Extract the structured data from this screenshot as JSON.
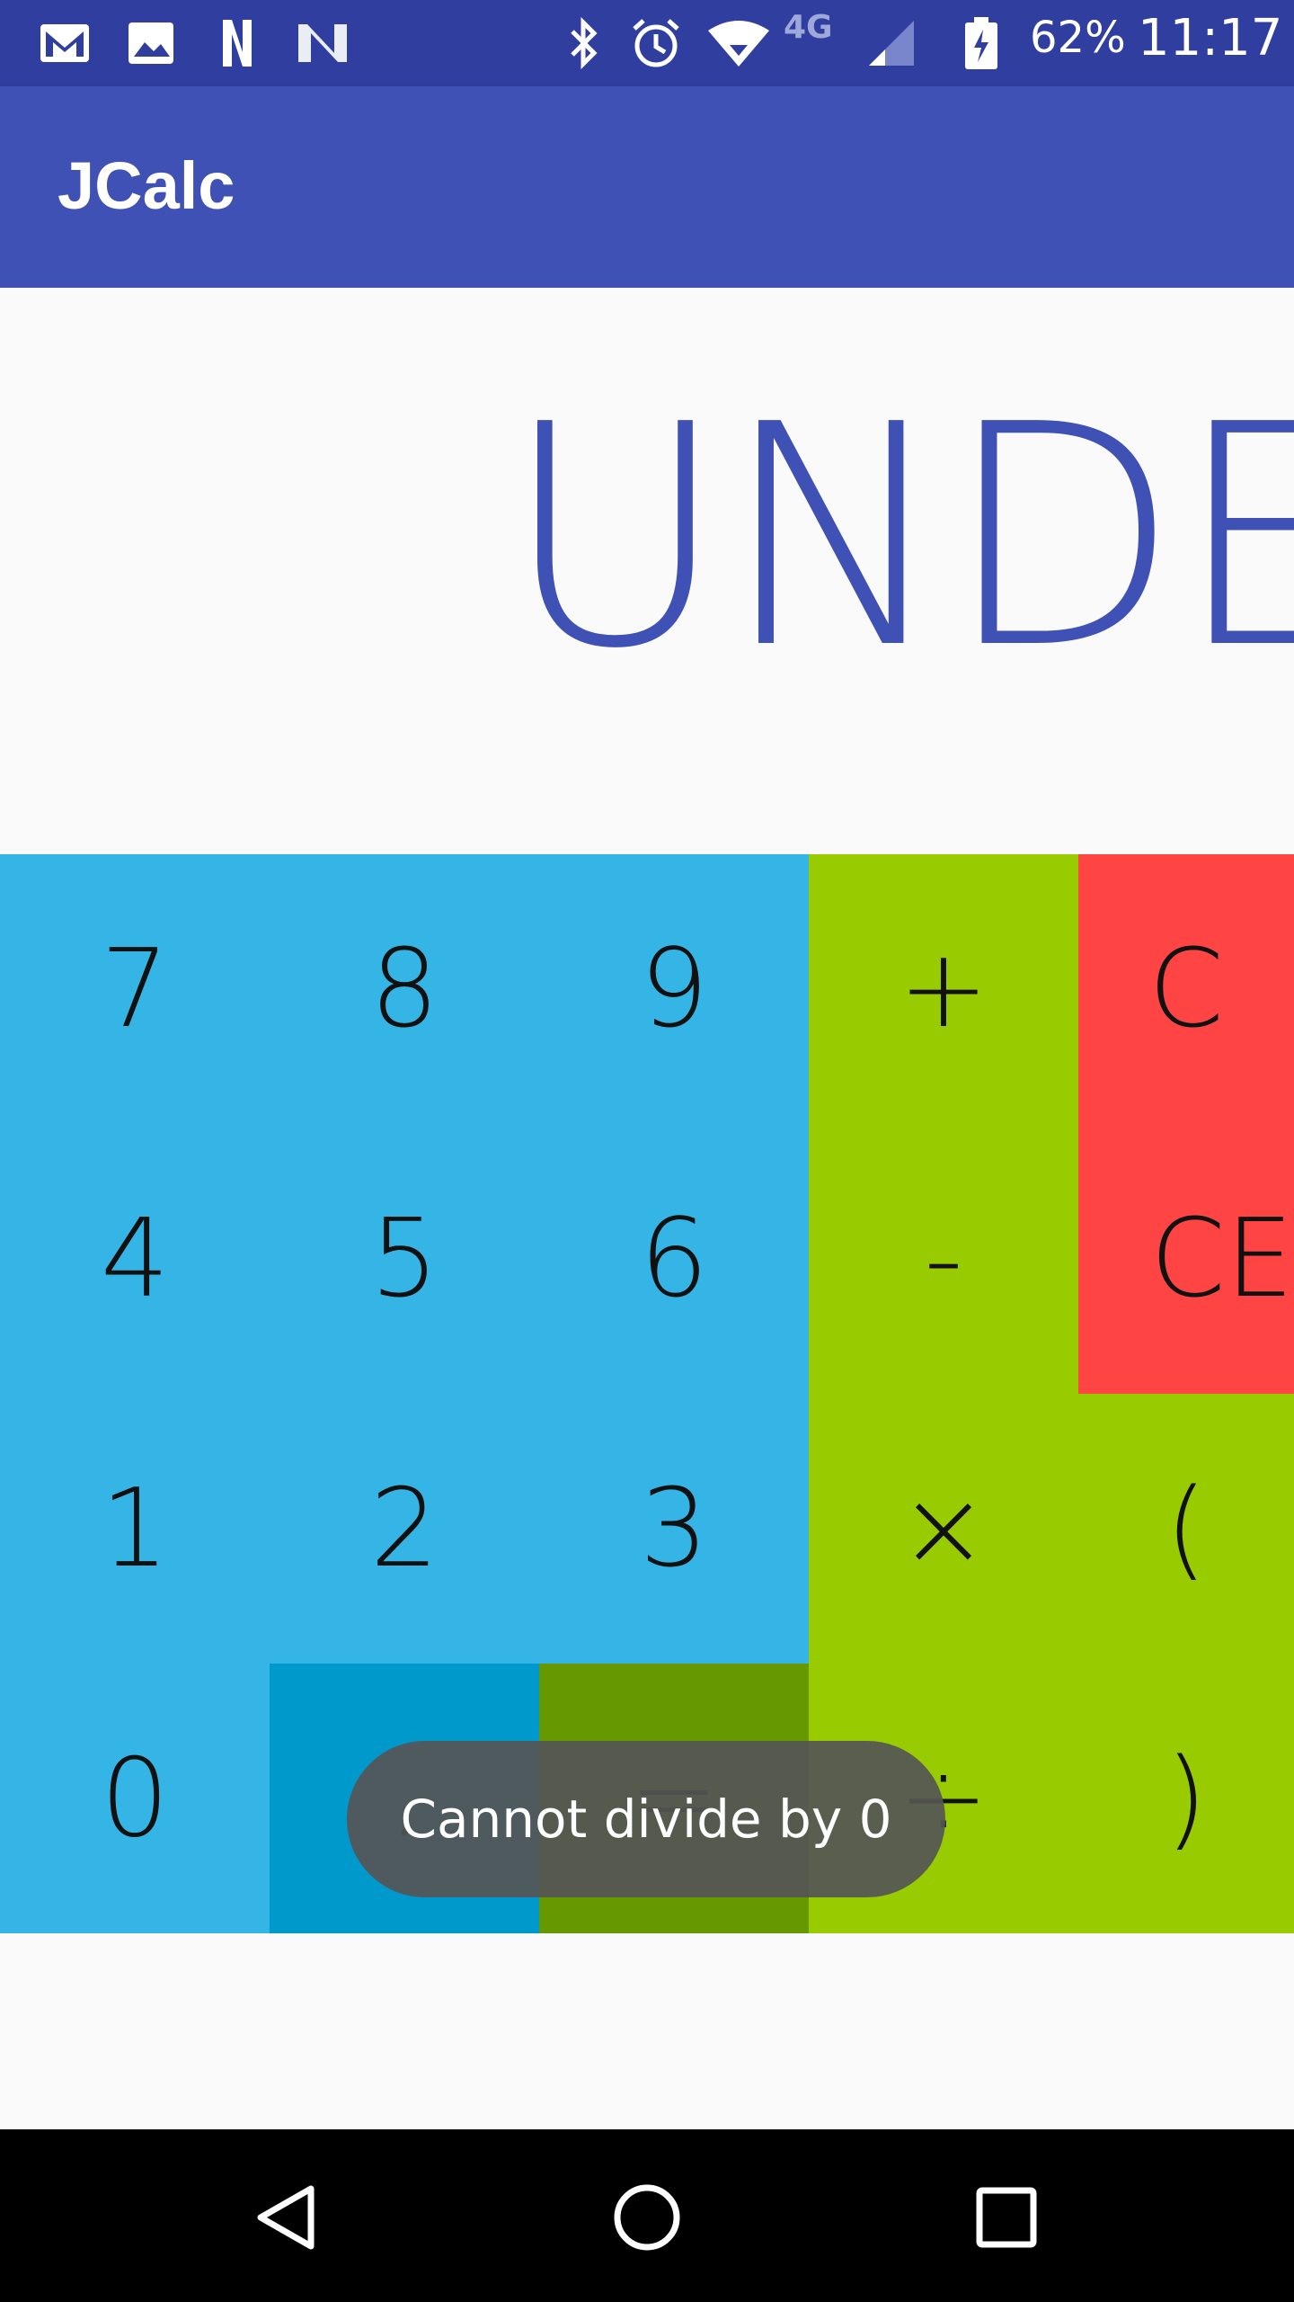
{
  "status_bar": {
    "battery": "62%",
    "time": "11:17",
    "network": "4G",
    "icons": [
      "gmail-icon",
      "photo-icon",
      "n-icon",
      "n-alt-icon",
      "bluetooth-icon",
      "alarm-icon",
      "wifi-icon",
      "signal-icon",
      "battery-icon"
    ]
  },
  "app_bar": {
    "title": "JCalc"
  },
  "display": {
    "text": "UNDEF"
  },
  "keypad": {
    "rows": [
      [
        "7",
        "8",
        "9",
        "+",
        "C"
      ],
      [
        "4",
        "5",
        "6",
        "-",
        "CE"
      ],
      [
        "1",
        "2",
        "3",
        "×",
        "("
      ],
      [
        "0",
        ".",
        "=",
        "÷",
        ")"
      ]
    ]
  },
  "toast": {
    "message": "Cannot divide by 0"
  },
  "nav_bar": {
    "buttons": [
      "back-icon",
      "home-icon",
      "recents-icon"
    ]
  }
}
